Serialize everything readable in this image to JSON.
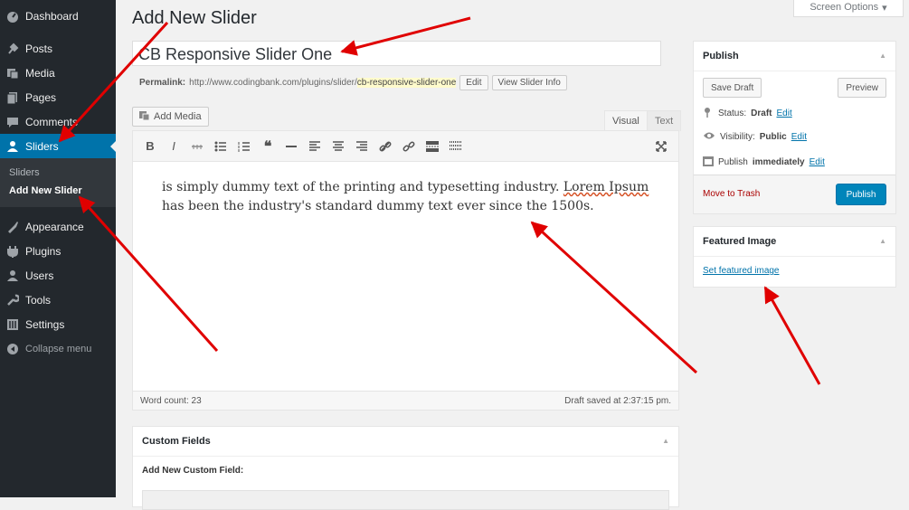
{
  "sidebar": {
    "items": [
      {
        "label": "Dashboard",
        "icon": "dashboard-icon"
      },
      {
        "label": "Posts",
        "icon": "pin-icon"
      },
      {
        "label": "Media",
        "icon": "media-icon"
      },
      {
        "label": "Pages",
        "icon": "pages-icon"
      },
      {
        "label": "Comments",
        "icon": "comment-icon"
      },
      {
        "label": "Sliders",
        "icon": "user-icon"
      },
      {
        "label": "Appearance",
        "icon": "brush-icon"
      },
      {
        "label": "Plugins",
        "icon": "plugin-icon"
      },
      {
        "label": "Users",
        "icon": "user-icon"
      },
      {
        "label": "Tools",
        "icon": "wrench-icon"
      },
      {
        "label": "Settings",
        "icon": "settings-icon"
      }
    ],
    "submenu": [
      "Sliders",
      "Add New Slider"
    ],
    "collapse_label": "Collapse menu"
  },
  "screen_options": "Screen Options",
  "page_title": "Add New Slider",
  "title_value": "CB Responsive Slider One",
  "permalink": {
    "label": "Permalink:",
    "base": "http://www.codingbank.com/plugins/slider/",
    "slug": "cb-responsive-slider-one",
    "edit": "Edit",
    "view": "View Slider Info"
  },
  "add_media": "Add Media",
  "tabs": {
    "visual": "Visual",
    "text": "Text"
  },
  "editor": {
    "text_before": "is simply dummy text of the printing and typesetting industry. ",
    "text_typo": "Lorem Ipsum",
    "text_after": " has been the industry's standard dummy text ever since the 1500s.",
    "word_count": "Word count: 23",
    "draft_saved": "Draft saved at 2:37:15 pm."
  },
  "custom_fields": {
    "title": "Custom Fields",
    "add_label": "Add New Custom Field:"
  },
  "publish": {
    "title": "Publish",
    "save_draft": "Save Draft",
    "preview": "Preview",
    "status_label": "Status:",
    "status_value": "Draft",
    "visibility_label": "Visibility:",
    "visibility_value": "Public",
    "publish_label": "Publish",
    "publish_value": "immediately",
    "edit": "Edit",
    "trash": "Move to Trash",
    "publish_button": "Publish"
  },
  "featured": {
    "title": "Featured Image",
    "link": "Set featured image"
  },
  "colors": {
    "sidebar": "#23282d",
    "accent": "#0073aa",
    "annotation": "#e00000"
  }
}
